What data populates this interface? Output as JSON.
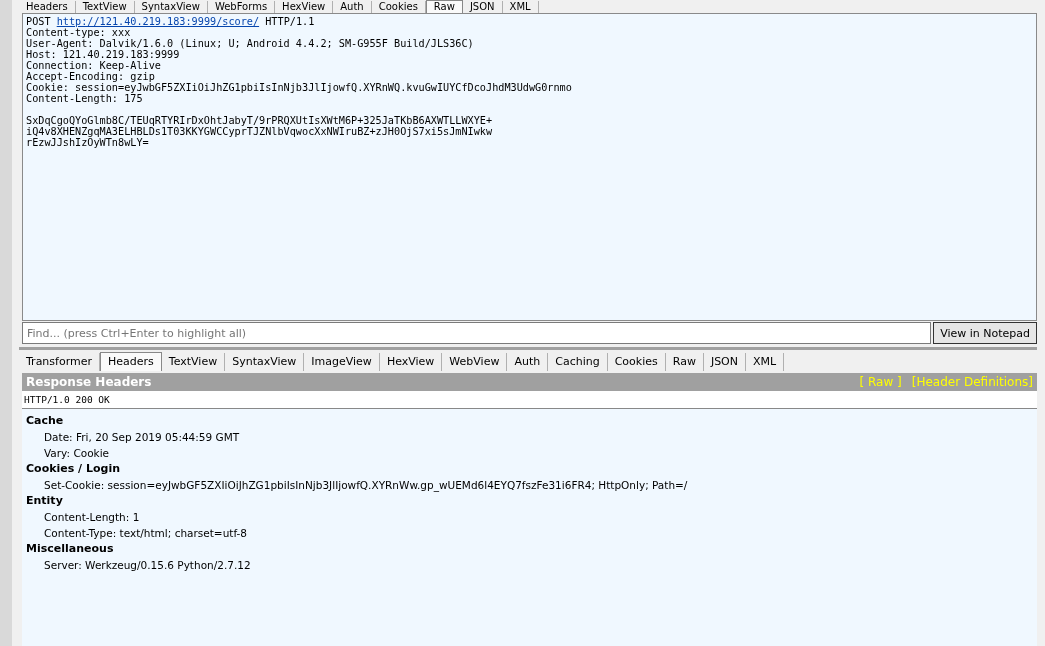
{
  "request_tabs": [
    {
      "label": "Headers",
      "selected": false
    },
    {
      "label": "TextView",
      "selected": false
    },
    {
      "label": "SyntaxView",
      "selected": false
    },
    {
      "label": "WebForms",
      "selected": false
    },
    {
      "label": "HexView",
      "selected": false
    },
    {
      "label": "Auth",
      "selected": false
    },
    {
      "label": "Cookies",
      "selected": false
    },
    {
      "label": "Raw",
      "selected": true
    },
    {
      "label": "JSON",
      "selected": false
    },
    {
      "label": "XML",
      "selected": false
    }
  ],
  "request_raw": {
    "method": "POST",
    "url": "http://121.40.219.183:9999/score/",
    "protocol": "HTTP/1.1",
    "lines": [
      "Content-type: xxx",
      "User-Agent: Dalvik/1.6.0 (Linux; U; Android 4.4.2; SM-G955F Build/JLS36C)",
      "Host: 121.40.219.183:9999",
      "Connection: Keep-Alive",
      "Accept-Encoding: gzip",
      "Cookie: session=eyJwbGF5ZXIiOiJhZG1pbiIsInNjb3JlIjowfQ.XYRnWQ.kvuGwIUYCfDcoJhdM3UdwG0rnmo",
      "Content-Length: 175"
    ],
    "body": [
      "SxDqCgoQYoGlmb8C/TEUqRTYRIrDxOhtJabyT/9rPRQXUtIsXWtM6P+325JaTKbB6AXWTLLWXYE+",
      "iQ4v8XHENZgqMA3ELHBLDs1T03KKYGWCCyprTJZNlbVqwocXxNWIruBZ+zJH0OjS7xi5sJmNIwkw",
      "rEzwJJshIzOyWTn8wLY="
    ]
  },
  "find_bar": {
    "placeholder": "Find... (press Ctrl+Enter to highlight all)",
    "button": "View in Notepad"
  },
  "response_tabs": [
    {
      "label": "Transformer",
      "selected": false
    },
    {
      "label": "Headers",
      "selected": true
    },
    {
      "label": "TextView",
      "selected": false
    },
    {
      "label": "SyntaxView",
      "selected": false
    },
    {
      "label": "ImageView",
      "selected": false
    },
    {
      "label": "HexView",
      "selected": false
    },
    {
      "label": "WebView",
      "selected": false
    },
    {
      "label": "Auth",
      "selected": false
    },
    {
      "label": "Caching",
      "selected": false
    },
    {
      "label": "Cookies",
      "selected": false
    },
    {
      "label": "Raw",
      "selected": false
    },
    {
      "label": "JSON",
      "selected": false
    },
    {
      "label": "XML",
      "selected": false
    }
  ],
  "response_headers": {
    "title": "Response Headers",
    "links": [
      "[ Raw ]",
      "[Header Definitions]"
    ],
    "status_line": "HTTP/1.0 200 OK",
    "groups": [
      {
        "name": "Cache",
        "items": [
          "Date: Fri, 20 Sep 2019 05:44:59 GMT",
          "Vary: Cookie"
        ]
      },
      {
        "name": "Cookies / Login",
        "items": [
          "Set-Cookie: session=eyJwbGF5ZXIiOiJhZG1pbiIsInNjb3JlIjowfQ.XYRnWw.gp_wUEMd6l4EYQ7fszFe31i6FR4; HttpOnly; Path=/"
        ]
      },
      {
        "name": "Entity",
        "items": [
          "Content-Length: 1",
          "Content-Type: text/html; charset=utf-8"
        ]
      },
      {
        "name": "Miscellaneous",
        "items": [
          "Server: Werkzeug/0.15.6 Python/2.7.12"
        ]
      }
    ]
  }
}
